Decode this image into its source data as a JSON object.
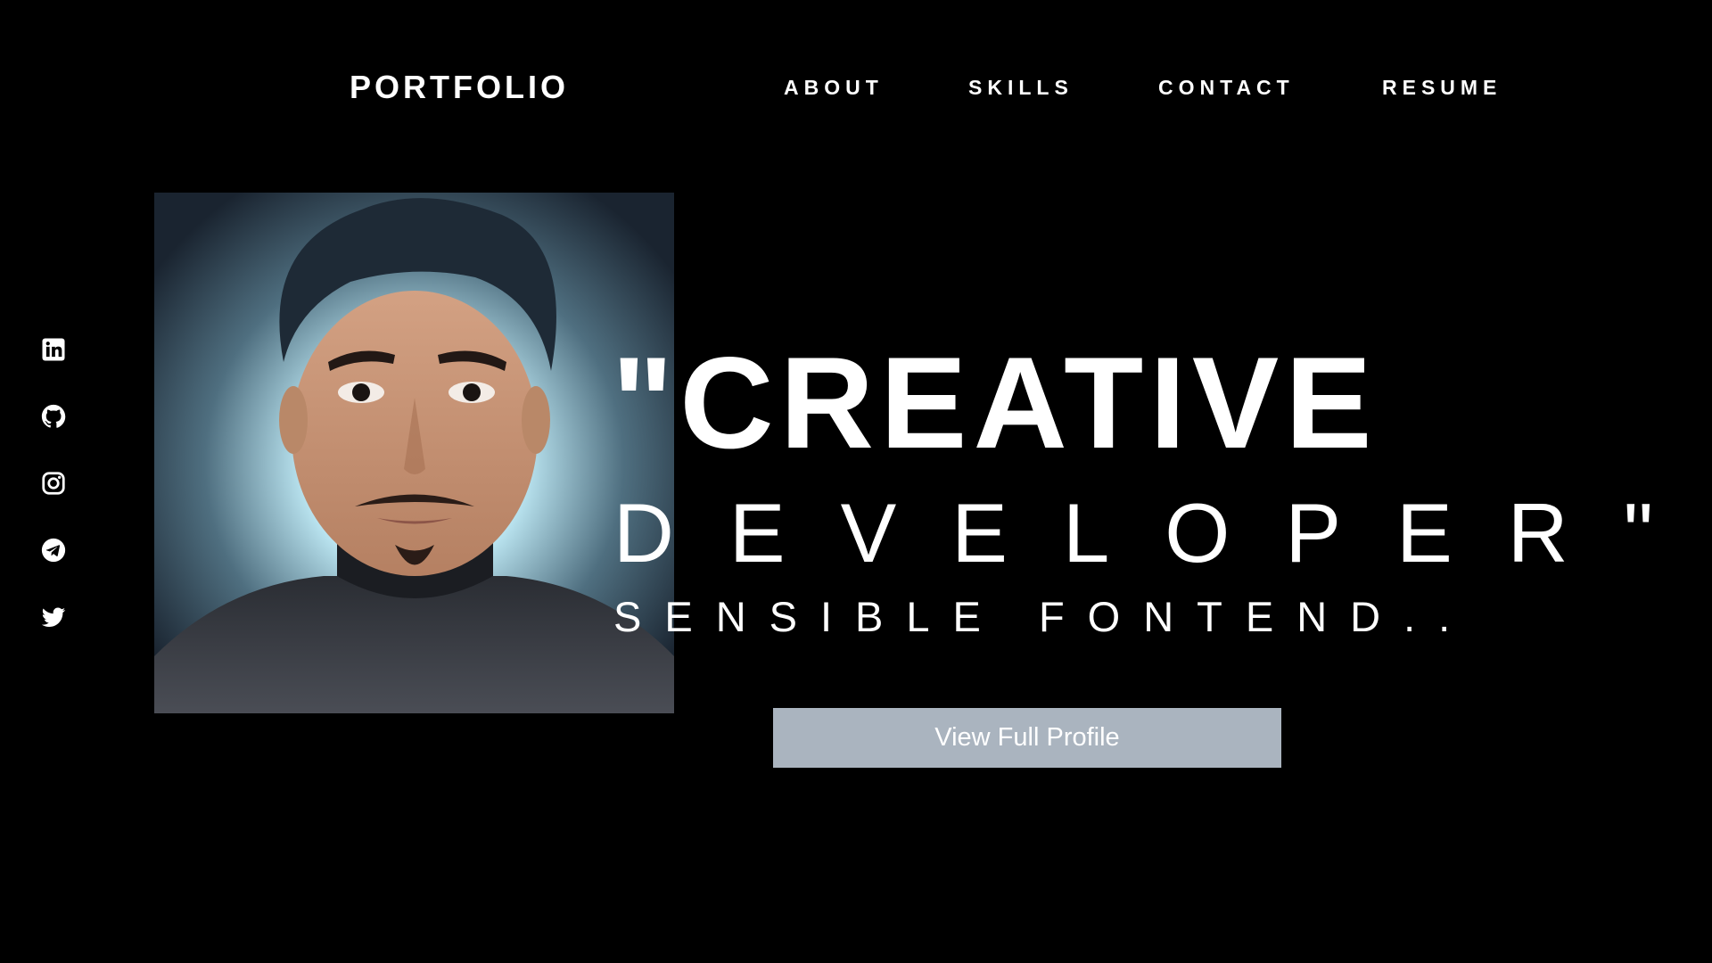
{
  "header": {
    "brand": "PORTFOLIO",
    "nav": [
      {
        "label": "ABOUT"
      },
      {
        "label": "SKILLS"
      },
      {
        "label": "CONTACT"
      },
      {
        "label": "RESUME"
      }
    ]
  },
  "social": [
    {
      "icon": "linkedin-icon"
    },
    {
      "icon": "github-icon"
    },
    {
      "icon": "instagram-icon"
    },
    {
      "icon": "telegram-icon"
    },
    {
      "icon": "twitter-icon"
    }
  ],
  "hero": {
    "line1": "\"CREATIVE",
    "line2": "DEVELOPER\"",
    "line3": "SENSIBLE FONTEND..",
    "cta_label": "View Full Profile"
  },
  "colors": {
    "background": "#000000",
    "text": "#ffffff",
    "button": "#aab4bf"
  }
}
